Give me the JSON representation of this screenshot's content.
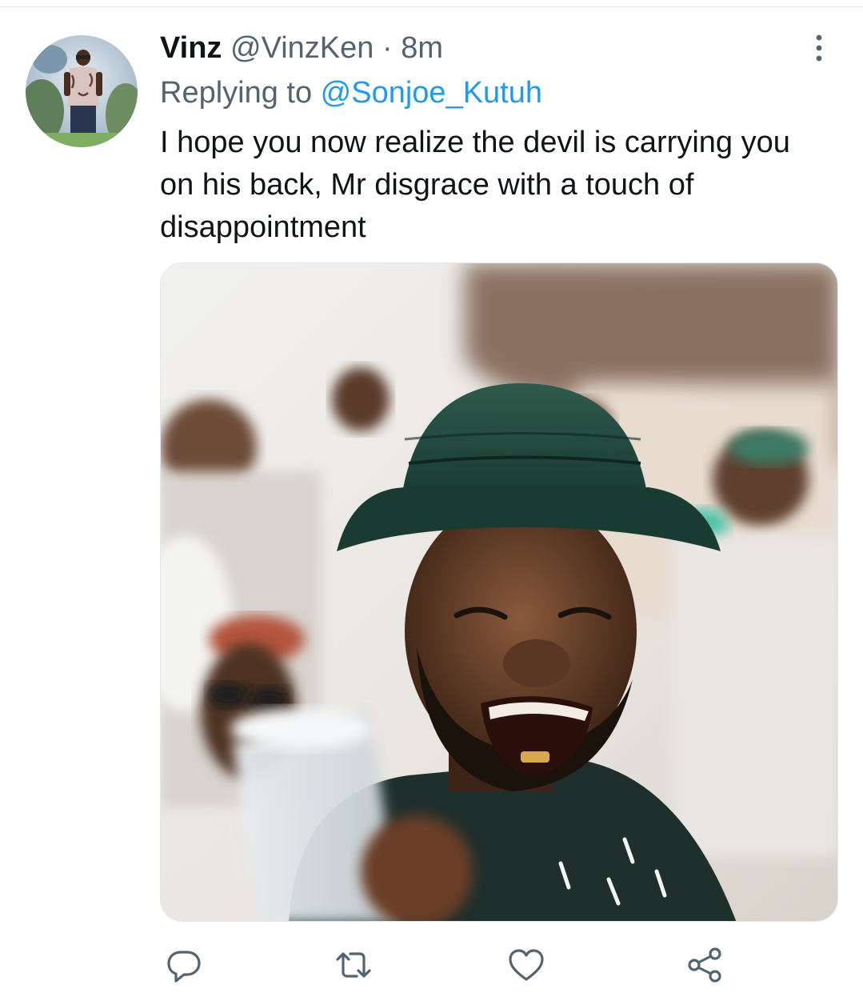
{
  "tweet": {
    "display_name": "Vinz",
    "handle": "@VinzKen",
    "separator": " · ",
    "time": "8m",
    "reply_prefix": "Replying to ",
    "reply_to": "@Sonjoe_Kutuh",
    "text": "I hope you now realize the devil is carrying you on his back, Mr disgrace with a touch of disappointment"
  },
  "icons": {
    "more": "more-vertical-icon",
    "reply": "reply-icon",
    "retweet": "retweet-icon",
    "like": "heart-icon",
    "share": "share-icon"
  },
  "colors": {
    "text": "#0f1419",
    "secondary": "#536471",
    "link": "#1d9bf0",
    "icon": "#536471"
  }
}
